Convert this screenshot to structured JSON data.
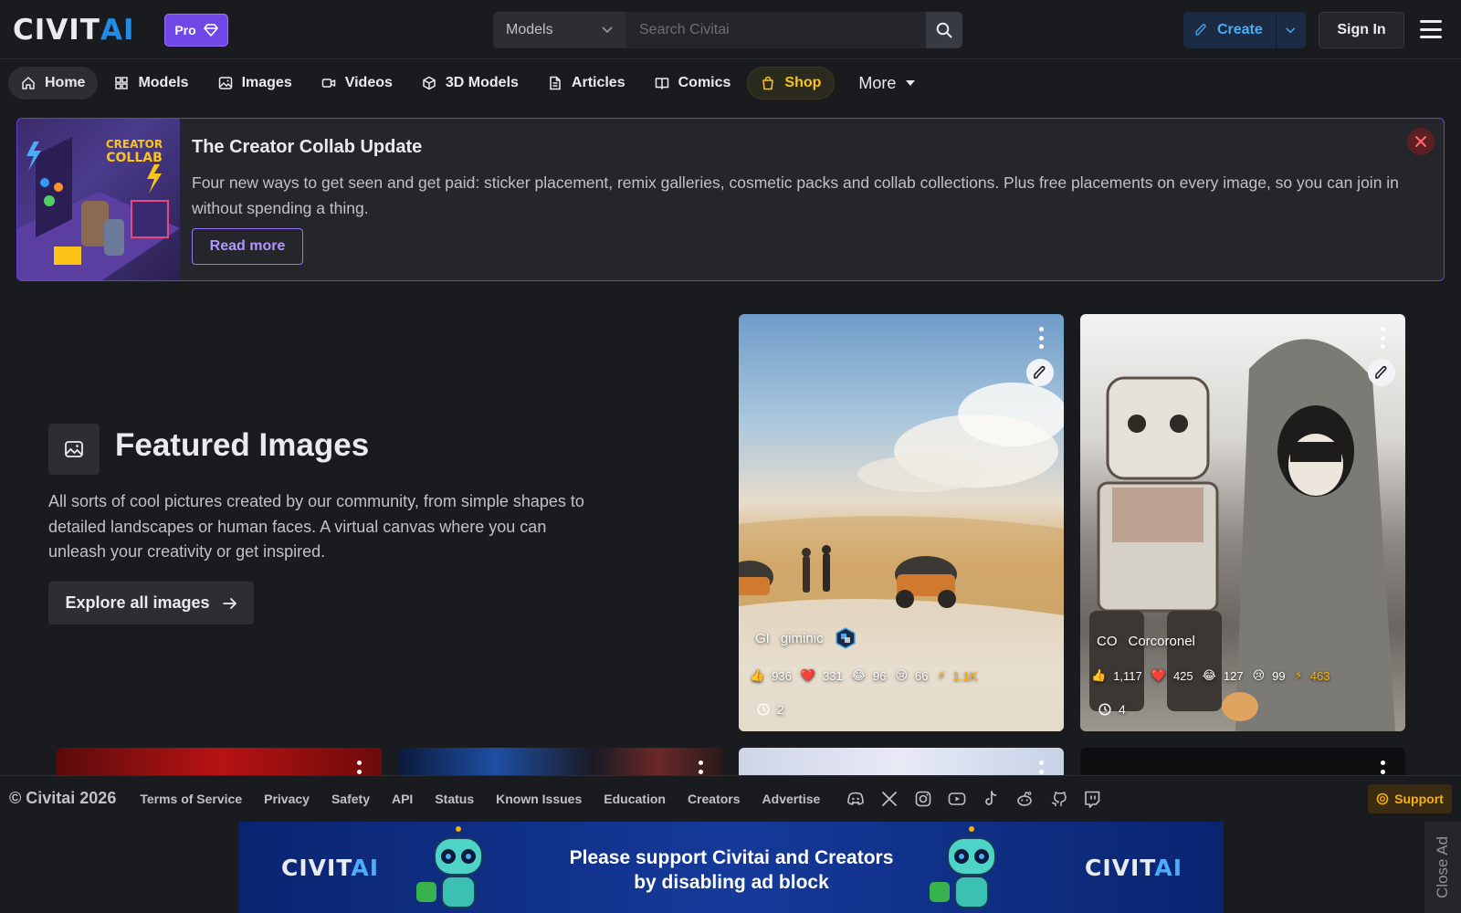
{
  "header": {
    "logo_text_a": "CIVIT",
    "logo_text_b": "AI",
    "pro_label": "Pro",
    "search_category": "Models",
    "search_placeholder": "Search Civitai",
    "search_shortcut": "/",
    "create_label": "Create",
    "signin_label": "Sign In"
  },
  "nav": {
    "items": [
      {
        "label": "Home",
        "icon": "home-icon"
      },
      {
        "label": "Models",
        "icon": "grid-icon"
      },
      {
        "label": "Images",
        "icon": "photo-icon"
      },
      {
        "label": "Videos",
        "icon": "video-icon"
      },
      {
        "label": "3D Models",
        "icon": "cube-icon"
      },
      {
        "label": "Articles",
        "icon": "file-icon"
      },
      {
        "label": "Comics",
        "icon": "book-icon"
      },
      {
        "label": "Shop",
        "icon": "shopping-bag-icon"
      }
    ],
    "more_label": "More"
  },
  "banner": {
    "image_text": "CREATOR COLLAB",
    "title": "The Creator Collab Update",
    "description": "Four new ways to get seen and get paid: sticker placement, remix galleries, cosmetic packs and collab collections. Plus free placements on every image, so you can join in without spending a thing.",
    "cta_label": "Read more"
  },
  "featured": {
    "title": "Featured Images",
    "description": "All sorts of cool pictures created by our community, from simple shapes to detailed landscapes or human faces. A virtual canvas where you can unleash your creativity or get inspired.",
    "cta_label": "Explore all images"
  },
  "cards": [
    {
      "avatar_initials": "GI",
      "username": "giminic",
      "likes": "936",
      "hearts": "331",
      "laughs": "96",
      "cries": "66",
      "buzz": "1.1K",
      "comments": "2"
    },
    {
      "avatar_initials": "CO",
      "username": "Corcoronel",
      "likes": "1,117",
      "hearts": "425",
      "laughs": "127",
      "cries": "99",
      "buzz": "463",
      "comments": "4"
    }
  ],
  "footer": {
    "copyright": "© Civitai 2026",
    "links": [
      "Terms of Service",
      "Privacy",
      "Safety",
      "API",
      "Status",
      "Known Issues",
      "Education",
      "Creators",
      "Advertise"
    ],
    "social_icons": [
      "discord-icon",
      "x-icon",
      "instagram-icon",
      "youtube-icon",
      "tiktok-icon",
      "reddit-icon",
      "github-icon",
      "twitch-icon"
    ],
    "support_label": "Support"
  },
  "ad": {
    "logo_a": "CIVIT",
    "logo_b": "AI",
    "line1": "Please support Civitai and Creators",
    "line2": "by disabling ad block",
    "close_label": "Close Ad"
  },
  "colors": {
    "accent": "#228be6",
    "pro": "#7048e8",
    "banner_border": "#6741d9",
    "shop": "#fcc419",
    "buzz": "#fab005"
  }
}
